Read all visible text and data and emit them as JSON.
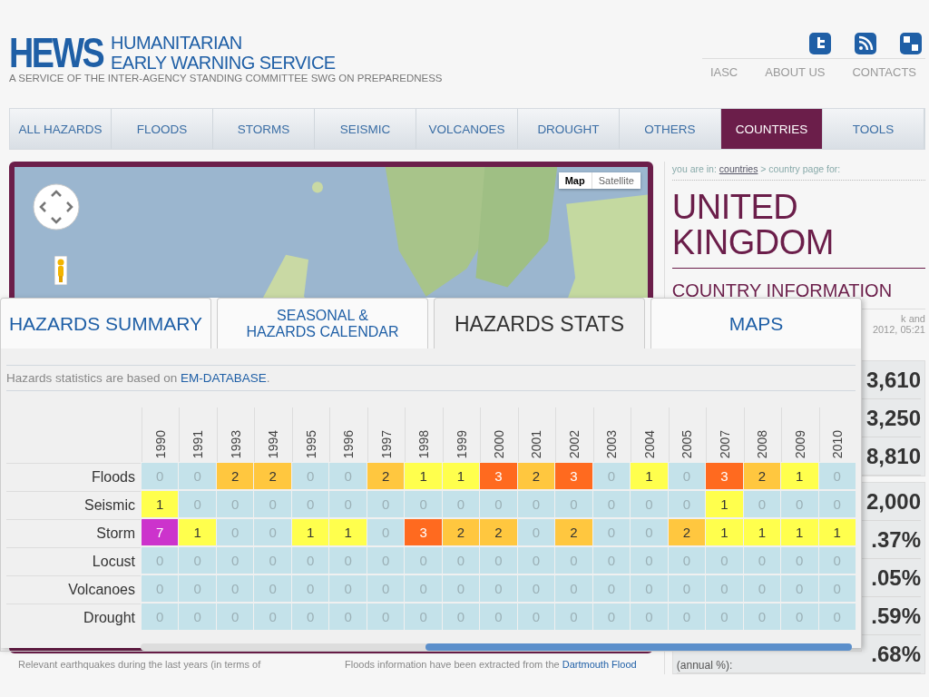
{
  "site": {
    "logo": "HEWS",
    "title_lines": [
      "HUMANITARIAN",
      "EARLY WARNING SERVICE"
    ],
    "tagline": "A SERVICE OF THE INTER-AGENCY STANDING COMMITTEE SWG ON PREPAREDNESS"
  },
  "top_links": [
    "IASC",
    "ABOUT US",
    "CONTACTS"
  ],
  "nav": [
    {
      "label": "ALL HAZARDS",
      "selected": false
    },
    {
      "label": "FLOODS",
      "selected": false
    },
    {
      "label": "STORMS",
      "selected": false
    },
    {
      "label": "SEISMIC",
      "selected": false
    },
    {
      "label": "VOLCANOES",
      "selected": false
    },
    {
      "label": "DROUGHT",
      "selected": false
    },
    {
      "label": "OTHERS",
      "selected": false
    },
    {
      "label": "COUNTRIES",
      "selected": true
    },
    {
      "label": "TOOLS",
      "selected": false
    }
  ],
  "map": {
    "kind": "picture",
    "map_types": [
      {
        "label": "Map",
        "selected": true
      },
      {
        "label": "Satellite",
        "selected": false
      }
    ]
  },
  "country": {
    "breadcrumb_prefix": "you are in:",
    "breadcrumb_link": "countries",
    "breadcrumb_suffix": "> country page for:",
    "name_lines": [
      "UNITED",
      "KINGDOM"
    ],
    "section": "COUNTRY INFORMATION",
    "notes": [
      "k and",
      "2012, 05:21"
    ],
    "stat_groups": [
      [
        {
          "value": "3,610"
        },
        {
          "value": "3,250"
        },
        {
          "value": "8,810"
        }
      ],
      [
        {
          "value": "2,000"
        },
        {
          "value": ".37%"
        },
        {
          "value": ".05%"
        },
        {
          "value": ".59%"
        },
        {
          "value": ".68%",
          "label": "(annual %):"
        }
      ]
    ]
  },
  "panel": {
    "tabs": [
      {
        "lines": [
          "HAZARDS SUMMARY"
        ],
        "selected": false
      },
      {
        "lines": [
          "SEASONAL &",
          "HAZARDS CALENDAR"
        ],
        "selected": false
      },
      {
        "lines": [
          "HAZARDS STATS"
        ],
        "selected": true
      },
      {
        "lines": [
          "MAPS"
        ],
        "selected": false
      }
    ],
    "source_text": "Hazards statistics are based on ",
    "source_link": "EM-DATABASE",
    "source_end": ".",
    "years": [
      "1990",
      "1991",
      "1993",
      "1994",
      "1995",
      "1996",
      "1997",
      "1998",
      "1999",
      "2000",
      "2001",
      "2002",
      "2003",
      "2004",
      "2005",
      "2007",
      "2008",
      "2009",
      "2010"
    ],
    "rows": [
      {
        "hazard": "Floods",
        "counts": [
          "0",
          "0",
          "2",
          "2",
          "0",
          "0",
          "2",
          "1",
          "1",
          "3",
          "2",
          "3",
          "0",
          "1",
          "0",
          "3",
          "2",
          "1",
          "0"
        ]
      },
      {
        "hazard": "Seismic",
        "counts": [
          "1",
          "0",
          "0",
          "0",
          "0",
          "0",
          "0",
          "0",
          "0",
          "0",
          "0",
          "0",
          "0",
          "0",
          "0",
          "1",
          "0",
          "0",
          "0"
        ]
      },
      {
        "hazard": "Storm",
        "counts": [
          "7",
          "1",
          "0",
          "0",
          "1",
          "1",
          "0",
          "3",
          "2",
          "2",
          "0",
          "2",
          "0",
          "0",
          "2",
          "1",
          "1",
          "1",
          "1"
        ]
      },
      {
        "hazard": "Locust",
        "counts": [
          "0",
          "0",
          "0",
          "0",
          "0",
          "0",
          "0",
          "0",
          "0",
          "0",
          "0",
          "0",
          "0",
          "0",
          "0",
          "0",
          "0",
          "0",
          "0"
        ]
      },
      {
        "hazard": "Volcanoes",
        "counts": [
          "0",
          "0",
          "0",
          "0",
          "0",
          "0",
          "0",
          "0",
          "0",
          "0",
          "0",
          "0",
          "0",
          "0",
          "0",
          "0",
          "0",
          "0",
          "0"
        ]
      },
      {
        "hazard": "Drought",
        "counts": [
          "0",
          "0",
          "0",
          "0",
          "0",
          "0",
          "0",
          "0",
          "0",
          "0",
          "0",
          "0",
          "0",
          "0",
          "0",
          "0",
          "0",
          "0",
          "0"
        ]
      }
    ]
  },
  "footnotes": [
    {
      "text": "Relevant earthquakes during the last years (in terms of"
    },
    {
      "text": "Floods information have been extracted from the ",
      "link": "Dartmouth Flood"
    }
  ]
}
